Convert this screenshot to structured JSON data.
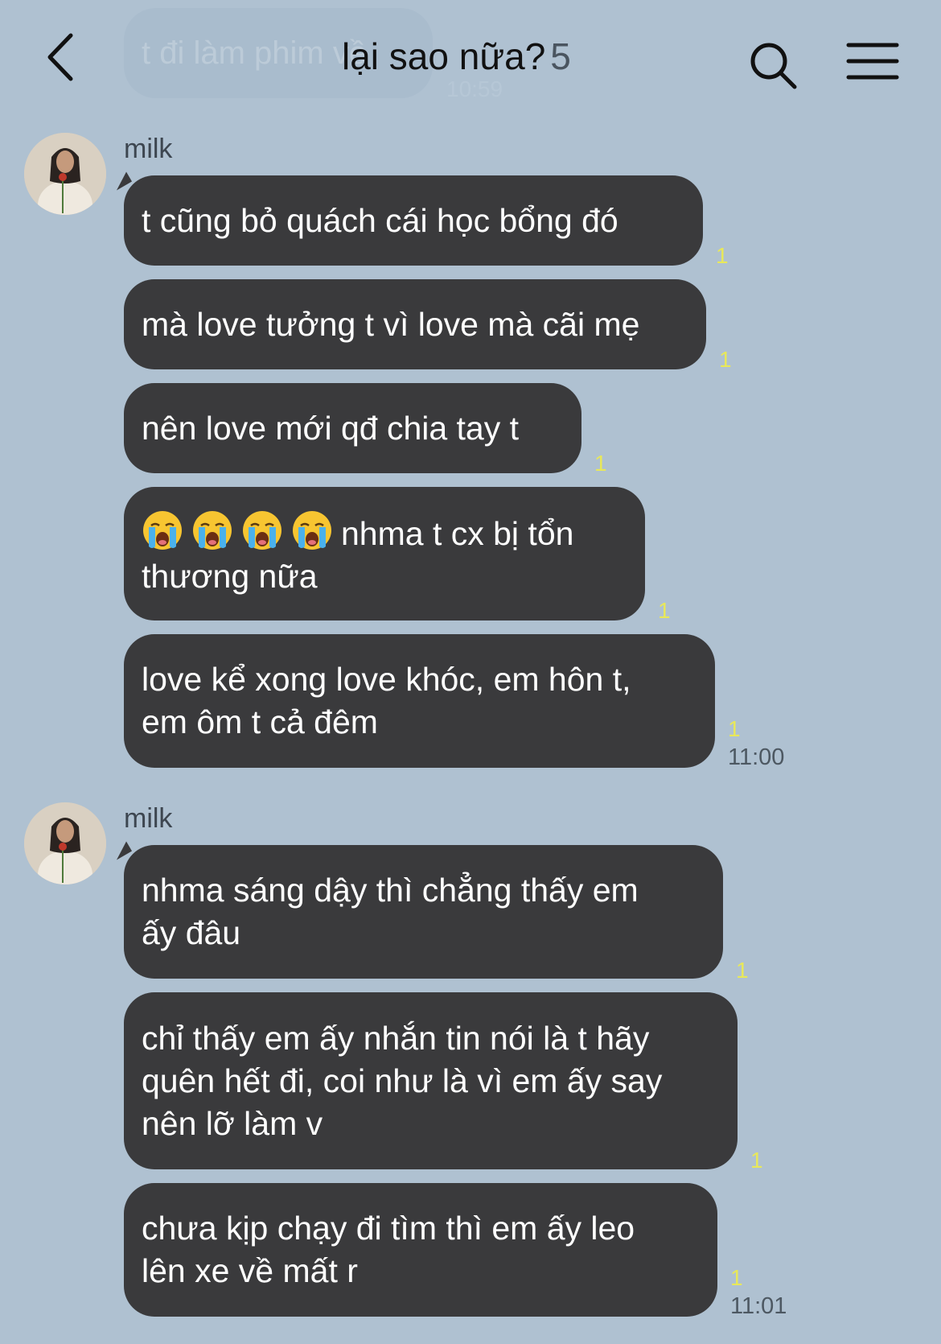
{
  "header": {
    "ghost_message": "t đi làm phim về",
    "ghost_time": "10:59",
    "title": "lại sao nữa?",
    "member_count": "5"
  },
  "groups": [
    {
      "sender": "milk",
      "time": "11:00",
      "messages": [
        {
          "lines": [
            "t cũng bỏ quách cái học bổng đó"
          ],
          "read": "1"
        },
        {
          "lines": [
            "mà love tưởng t vì love mà cãi mẹ"
          ],
          "read": "1"
        },
        {
          "lines": [
            "nên love mới qđ chia tay t"
          ],
          "read": "1"
        },
        {
          "lines": [
            "nhma t cx bị tổn",
            "thương nữa"
          ],
          "emoji_count": 4,
          "read": "1"
        },
        {
          "lines": [
            "love kể xong love khóc, em hôn t,",
            "em ôm t cả đêm"
          ],
          "read": "1"
        }
      ]
    },
    {
      "sender": "milk",
      "time": "11:01",
      "messages": [
        {
          "lines": [
            "nhma sáng dậy thì chẳng thấy em",
            "ấy đâu"
          ],
          "read": "1"
        },
        {
          "lines": [
            "chỉ thấy em ấy nhắn tin nói là t hãy",
            "quên hết đi, coi như là vì em ấy say",
            "nên lỡ làm v"
          ],
          "read": "1"
        },
        {
          "lines": [
            "chưa kịp chạy đi tìm thì em ấy leo",
            "lên xe về mất r"
          ],
          "read": "1"
        }
      ]
    }
  ],
  "colors": {
    "background": "#afc1d1",
    "bubble": "#3a3a3c",
    "read_receipt": "#e8e85a"
  },
  "icons": [
    "back-chevron-icon",
    "search-icon",
    "menu-icon",
    "crying-face-emoji"
  ]
}
